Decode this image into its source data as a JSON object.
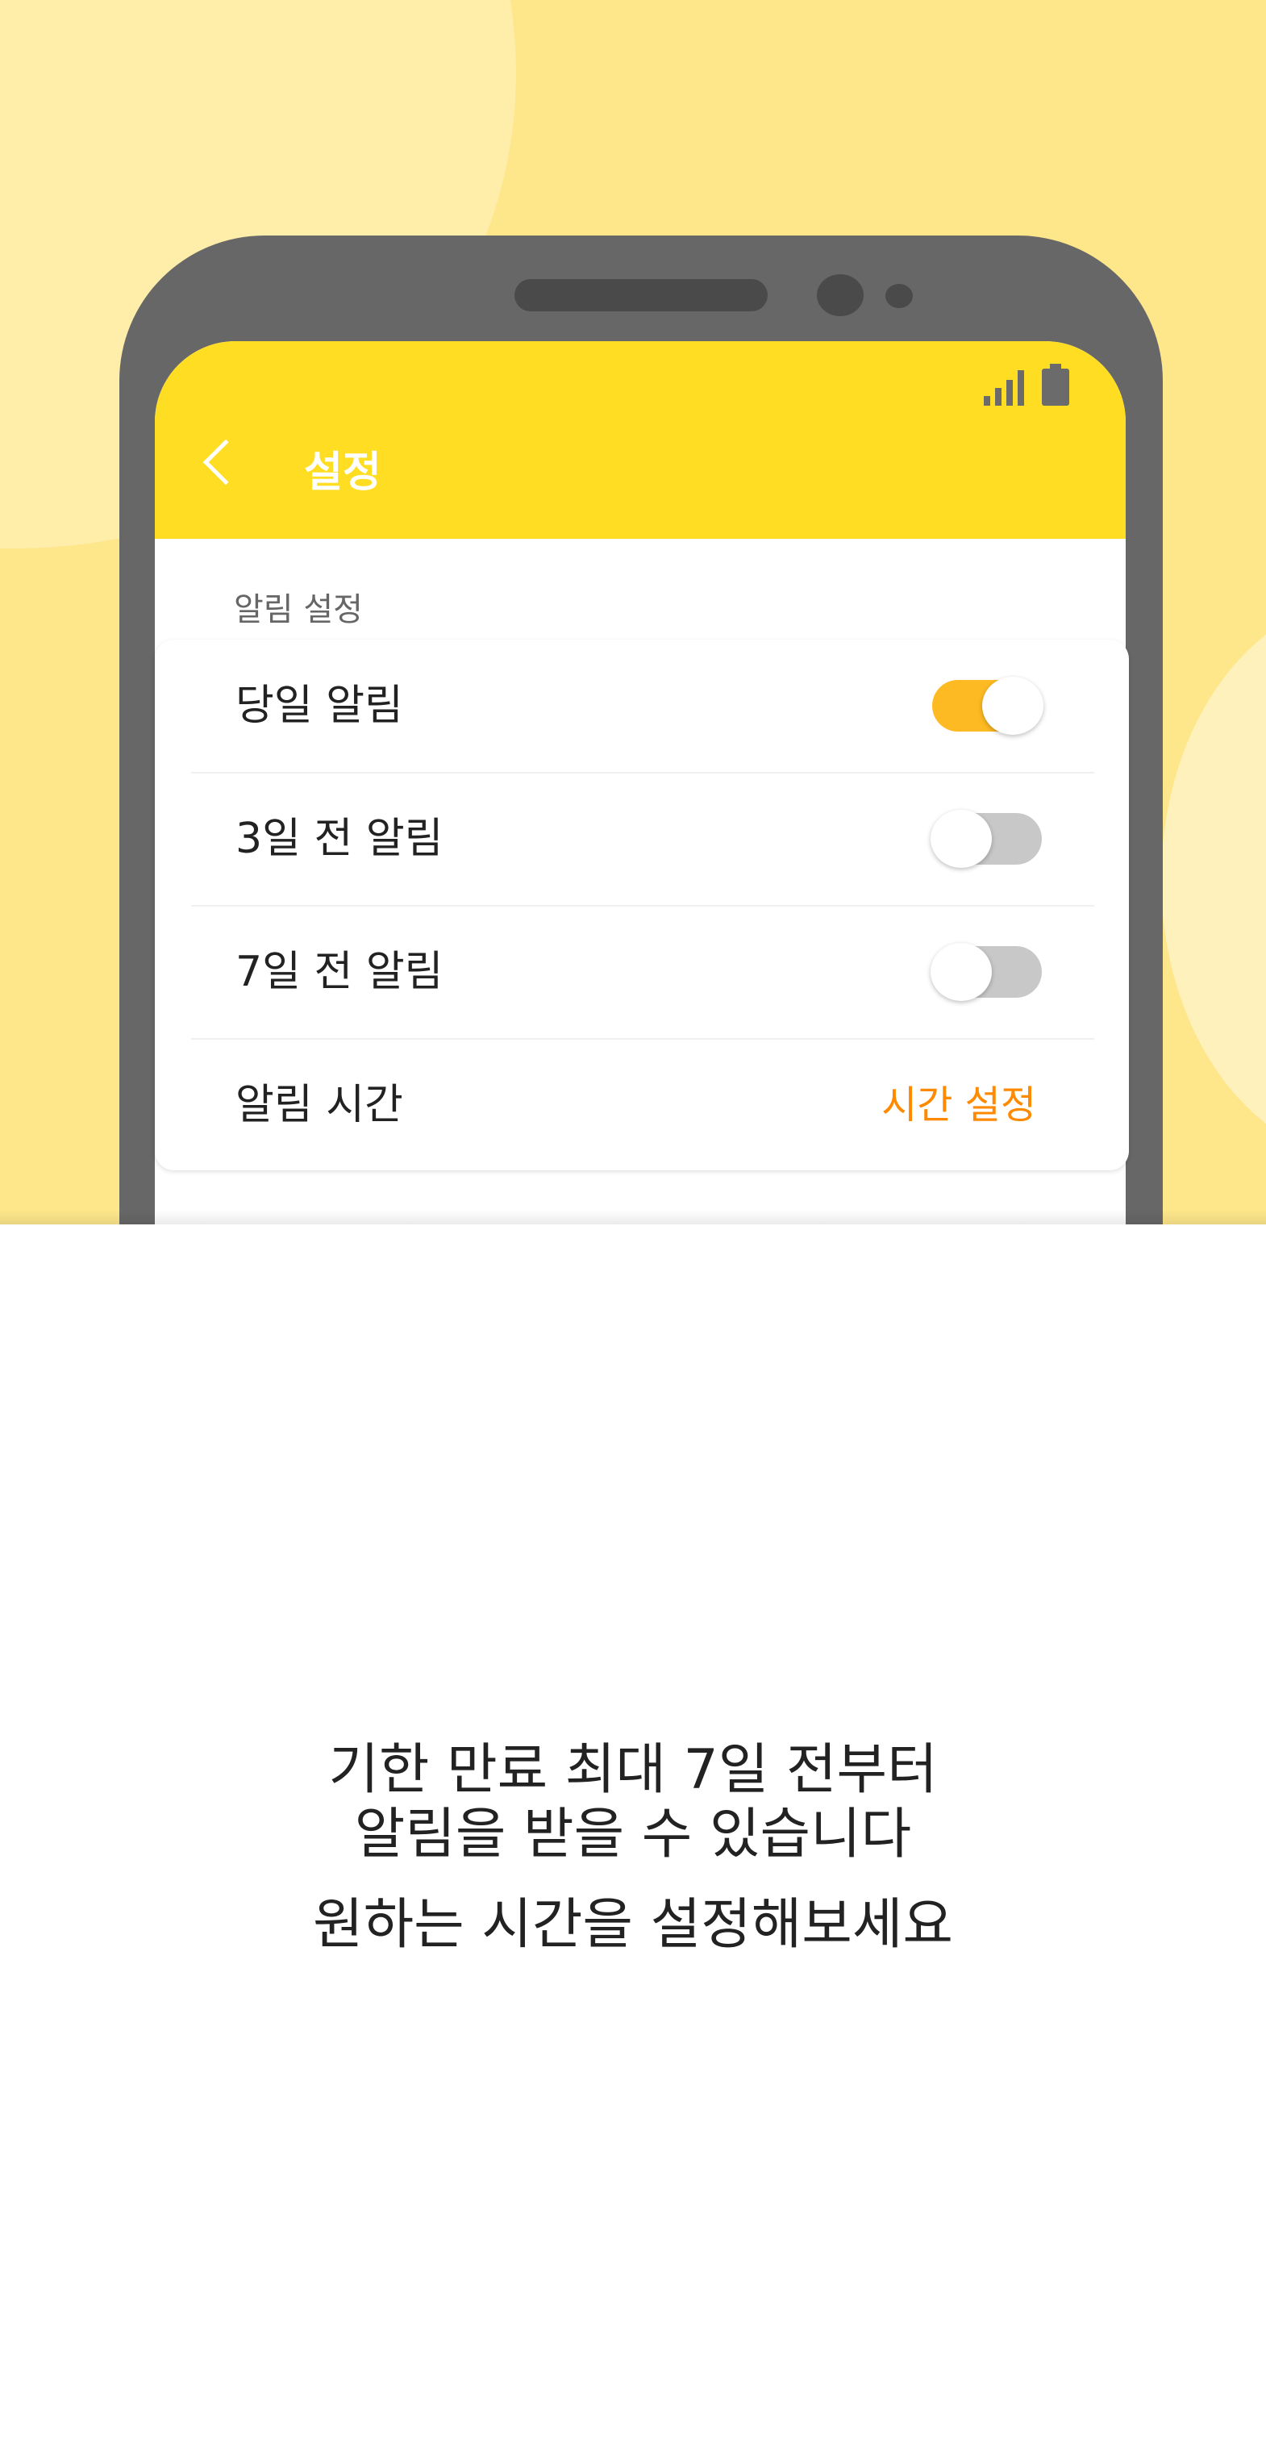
{
  "settings_screen": {
    "title": "설정",
    "section_label": "알림 설정",
    "rows": [
      {
        "label": "당일 알림",
        "toggle_on": true
      },
      {
        "label": "3일 전 알림",
        "toggle_on": false
      },
      {
        "label": "7일 전 알림",
        "toggle_on": false
      }
    ],
    "time_row": {
      "label": "알림 시간",
      "action": "시간 설정"
    }
  },
  "caption": {
    "line1": "기한 만료 최대 7일 전부터",
    "line2": "알림을 받을 수 있습니다",
    "line3": "원하는 시간을 설정해보세요"
  },
  "colors": {
    "background": "#FEE68A",
    "app_bar": "#FFDD22",
    "toggle_on": "#FDBA23",
    "accent_text": "#FF8A00",
    "phone_frame": "#676767"
  }
}
